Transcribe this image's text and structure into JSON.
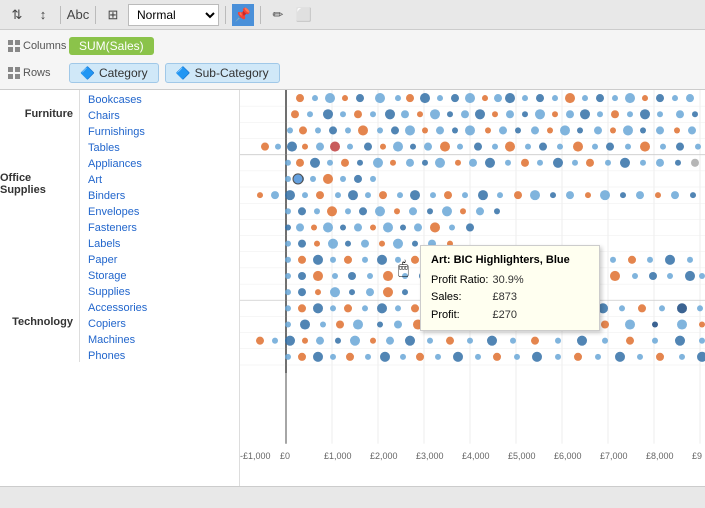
{
  "toolbar": {
    "sort_asc_label": "⇅",
    "sort_desc_label": "↕",
    "abc_label": "Abc",
    "chart_type_label": "▦",
    "view_mode": "Normal",
    "pin_label": "📌",
    "pencil_label": "✏",
    "comment_label": "⬜"
  },
  "shelves": {
    "columns_label": "Columns",
    "columns_icon": "grid",
    "columns_pill": "SUM(Sales)",
    "rows_label": "Rows",
    "rows_icon": "grid",
    "rows_category": "Category",
    "rows_subcategory": "Sub-Category"
  },
  "categories": [
    {
      "name": "Furniture",
      "subs": [
        "Bookcases",
        "Chairs",
        "Furnishings",
        "Tables"
      ]
    },
    {
      "name": "Office Supplies",
      "subs": [
        "Appliances",
        "Art",
        "Binders",
        "Envelopes",
        "Fasteners",
        "Labels",
        "Paper",
        "Storage",
        "Supplies"
      ]
    },
    {
      "name": "Technology",
      "subs": [
        "Accessories",
        "Copiers",
        "Machines",
        "Phones"
      ]
    }
  ],
  "xaxis": {
    "labels": [
      "-£1,000",
      "£0",
      "£1,000",
      "£2,000",
      "£3,000",
      "£4,000",
      "£5,000",
      "£6,000",
      "£7,000",
      "£8,000",
      "£9"
    ]
  },
  "tooltip": {
    "title": "Art: BIC Highlighters, Blue",
    "profit_ratio_label": "Profit Ratio:",
    "profit_ratio_value": "30.9%",
    "sales_label": "Sales:",
    "sales_value": "£873",
    "profit_label": "Profit:",
    "profit_value": "£270"
  },
  "colors": {
    "accent_blue": "#4a90d9",
    "pill_green": "#8bc34a",
    "tooltip_bg": "#fffff0"
  }
}
